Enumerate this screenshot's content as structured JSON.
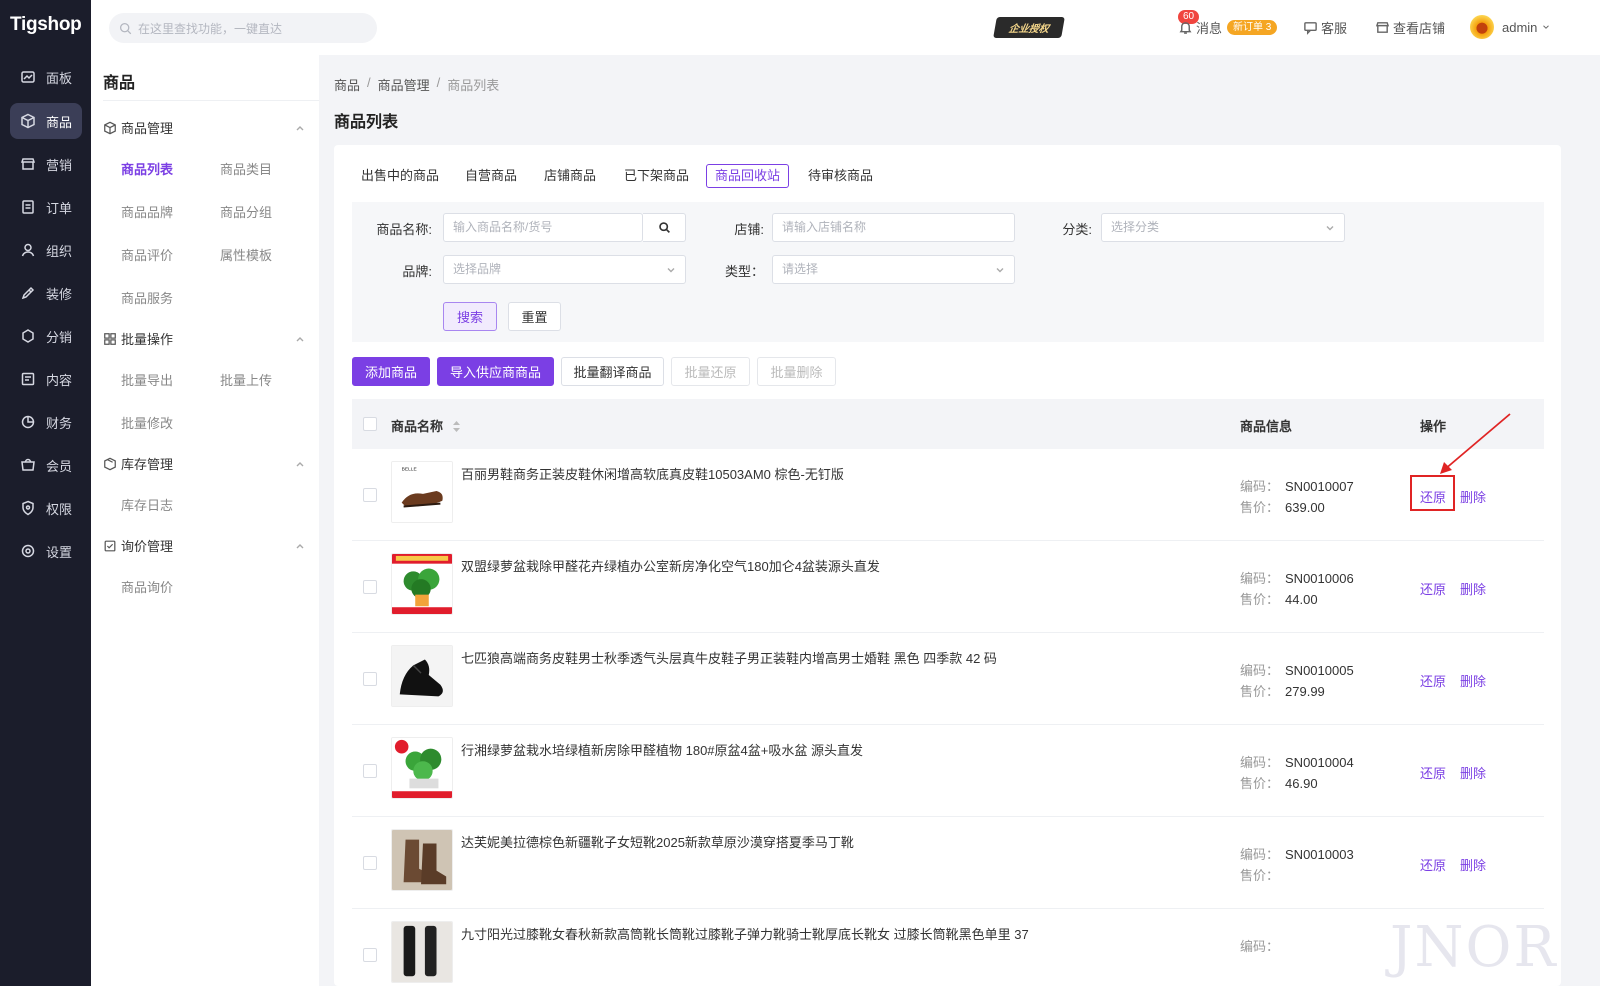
{
  "app": {
    "logo": "Tigshop"
  },
  "rail": [
    {
      "label": "面板",
      "icon": "dashboard-icon"
    },
    {
      "label": "商品",
      "icon": "box-icon",
      "active": true
    },
    {
      "label": "营销",
      "icon": "shop-icon"
    },
    {
      "label": "订单",
      "icon": "order-icon"
    },
    {
      "label": "组织",
      "icon": "user-icon"
    },
    {
      "label": "装修",
      "icon": "brush-icon"
    },
    {
      "label": "分销",
      "icon": "share-icon"
    },
    {
      "label": "内容",
      "icon": "content-icon"
    },
    {
      "label": "财务",
      "icon": "pie-icon"
    },
    {
      "label": "会员",
      "icon": "member-icon"
    },
    {
      "label": "权限",
      "icon": "shield-icon"
    },
    {
      "label": "设置",
      "icon": "settings-icon"
    }
  ],
  "topbar": {
    "search_placeholder": "在这里查找功能，一键直达",
    "auth_badge": "企业授权",
    "msg_count": "60",
    "msg_label": "消息",
    "new_order": "新订单 3",
    "service_label": "客服",
    "store_label": "查看店铺",
    "user": "admin"
  },
  "subnav": {
    "title": "商品",
    "groups": [
      {
        "label": "商品管理",
        "icon": "box-icon"
      },
      {
        "label": "批量操作",
        "icon": "grid-icon"
      },
      {
        "label": "库存管理",
        "icon": "cubes-icon"
      },
      {
        "label": "询价管理",
        "icon": "inquiry-icon"
      }
    ],
    "items": {
      "product_list": "商品列表",
      "product_category": "商品类目",
      "product_brand": "商品品牌",
      "product_group": "商品分组",
      "product_review": "商品评价",
      "attr_template": "属性模板",
      "product_service": "商品服务",
      "batch_export": "批量导出",
      "batch_upload": "批量上传",
      "batch_edit": "批量修改",
      "stock_log": "库存日志",
      "product_inquiry": "商品询价"
    }
  },
  "breadcrumb": [
    "商品",
    "商品管理",
    "商品列表"
  ],
  "page_title": "商品列表",
  "tabs": [
    "出售中的商品",
    "自营商品",
    "店铺商品",
    "已下架商品",
    "商品回收站",
    "待审核商品"
  ],
  "active_tab": "商品回收站",
  "filter": {
    "name_label": "商品名称:",
    "name_placeholder": "输入商品名称/货号",
    "store_label": "店铺:",
    "store_placeholder": "请输入店铺名称",
    "category_label": "分类:",
    "category_placeholder": "选择分类",
    "brand_label": "品牌:",
    "brand_placeholder": "选择品牌",
    "type_label": "类型：",
    "type_placeholder": "请选择",
    "search_btn": "搜索",
    "reset_btn": "重置"
  },
  "actions": {
    "add": "添加商品",
    "import": "导入供应商商品",
    "translate": "批量翻译商品",
    "restore": "批量还原",
    "delete": "批量删除"
  },
  "table": {
    "col_name": "商品名称",
    "col_info": "商品信息",
    "col_ops": "操作",
    "code_label": "编码：",
    "price_label": "售价：",
    "restore": "还原",
    "delete": "删除",
    "rows": [
      {
        "name": "百丽男鞋商务正装皮鞋休闲增高软底真皮鞋10503AM0 棕色-无钉版",
        "code": "SN0010007",
        "price": "639.00",
        "thumb": "shoe-brown"
      },
      {
        "name": "双盟绿萝盆栽除甲醛花卉绿植办公室新房净化空气180加仑4盆装源头直发",
        "code": "SN0010006",
        "price": "44.00",
        "thumb": "plant-red"
      },
      {
        "name": "七匹狼高端商务皮鞋男士秋季透气头层真牛皮鞋子男正装鞋内增高男士婚鞋 黑色 四季款 42 码",
        "code": "SN0010005",
        "price": "279.99",
        "thumb": "shoe-black"
      },
      {
        "name": "行湘绿萝盆栽水培绿植新房除甲醛植物 180#原盆4盆+吸水盆 源头直发",
        "code": "SN0010004",
        "price": "46.90",
        "thumb": "plant-green"
      },
      {
        "name": "达芙妮美拉德棕色新疆靴子女短靴2025新款草原沙漠穿搭夏季马丁靴",
        "code": "SN0010003",
        "price": "",
        "thumb": "boot-brown"
      },
      {
        "name": "九寸阳光过膝靴女春秋新款高筒靴长筒靴过膝靴子弹力靴骑士靴厚底长靴女 过膝长筒靴黑色单里 37",
        "code": "",
        "price": "",
        "thumb": "boot-black"
      }
    ]
  },
  "watermark": "JNOR",
  "colors": {
    "primary": "#7b3fe4",
    "rail": "#1b1d2b",
    "highlight": "#e02424"
  }
}
